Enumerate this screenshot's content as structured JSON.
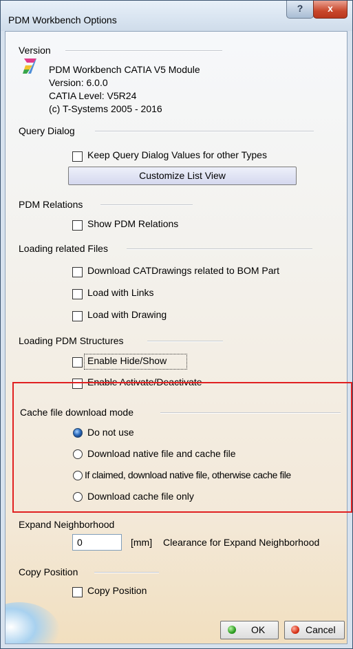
{
  "window": {
    "title": "PDM Workbench Options",
    "help_glyph": "?",
    "close_glyph": "x"
  },
  "version": {
    "heading": "Version",
    "lines": [
      "PDM Workbench CATIA V5 Module",
      "Version: 6.0.0",
      "CATIA Level: V5R24",
      "(c) T-Systems 2005 - 2016"
    ],
    "icon": "catia-logo-icon"
  },
  "query_dialog": {
    "heading": "Query Dialog",
    "keep_values_label": "Keep Query Dialog Values for other Types",
    "keep_values_checked": false,
    "customize_button": "Customize List View"
  },
  "pdm_relations": {
    "heading": "PDM Relations",
    "show_label": "Show PDM Relations",
    "show_checked": false
  },
  "loading_related": {
    "heading": "Loading related Files",
    "options": [
      {
        "label": "Download CATDrawings related to BOM Part",
        "checked": false
      },
      {
        "label": "Load with Links",
        "checked": false
      },
      {
        "label": "Load with Drawing",
        "checked": false
      }
    ]
  },
  "loading_structures": {
    "heading": "Loading PDM Structures",
    "options": [
      {
        "label": "Enable Hide/Show",
        "checked": false
      },
      {
        "label": "Enable Activate/Deactivate",
        "checked": false
      }
    ]
  },
  "cache_mode": {
    "heading": "Cache file download mode",
    "options": [
      {
        "label": "Do not use",
        "selected": true
      },
      {
        "label": "Download native file and cache file",
        "selected": false
      },
      {
        "label": "If claimed, download native file, otherwise cache file",
        "selected": false
      },
      {
        "label": "Download cache file only",
        "selected": false
      }
    ],
    "highlight_color": "#e02020"
  },
  "expand_neighborhood": {
    "heading": "Expand Neighborhood",
    "value": "0",
    "unit_label": "[mm]",
    "description": "Clearance for Expand Neighborhood"
  },
  "copy_position": {
    "heading": "Copy Position",
    "label": "Copy Position",
    "checked": false
  },
  "footer": {
    "ok_label": "OK",
    "cancel_label": "Cancel"
  }
}
